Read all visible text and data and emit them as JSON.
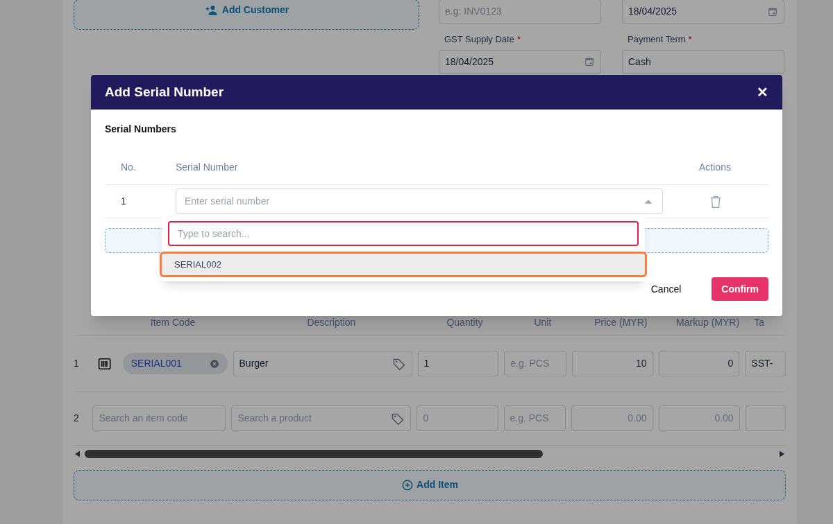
{
  "form": {
    "add_customer": "Add Customer",
    "fields": [
      {
        "placeholder": "e.g: INV0123",
        "kind": "text"
      },
      {
        "value": "18/04/2025",
        "kind": "date"
      },
      {
        "label": "GST Supply Date",
        "required_mark": "*",
        "value": "18/04/2025",
        "kind": "date"
      },
      {
        "label": "Payment Term",
        "required_mark": "*",
        "value": "Cash",
        "kind": "text"
      }
    ]
  },
  "items_table": {
    "columns": [
      "Item Code",
      "Description",
      "Quantity",
      "Unit",
      "Price (MYR)",
      "Markup (MYR)",
      "Ta"
    ],
    "rows": [
      {
        "no": "1",
        "item_code": "SERIAL001",
        "description": "Burger",
        "quantity": "1",
        "unit_placeholder": "e.g. PCS",
        "price": "10",
        "markup": "0",
        "tax": "SST-"
      },
      {
        "no": "2",
        "item_code_placeholder": "Search an item code",
        "description_placeholder": "Search a product",
        "quantity_placeholder": "0",
        "unit_placeholder": "e.g. PCS",
        "price_placeholder": "0.00",
        "markup_placeholder": "0.00"
      }
    ],
    "add_item": "Add Item"
  },
  "modal": {
    "title": "Add Serial Number",
    "close": "✕",
    "section": "Serial Numbers",
    "columns": [
      "No.",
      "Serial Number",
      "Actions"
    ],
    "rows": [
      {
        "no": "1",
        "placeholder": "Enter serial number",
        "expanded": true
      }
    ],
    "dropdown": {
      "search_placeholder": "Type to search...",
      "options": [
        {
          "label": "SERIAL002",
          "highlighted": true
        }
      ]
    },
    "cancel": "Cancel",
    "confirm": "Confirm"
  }
}
